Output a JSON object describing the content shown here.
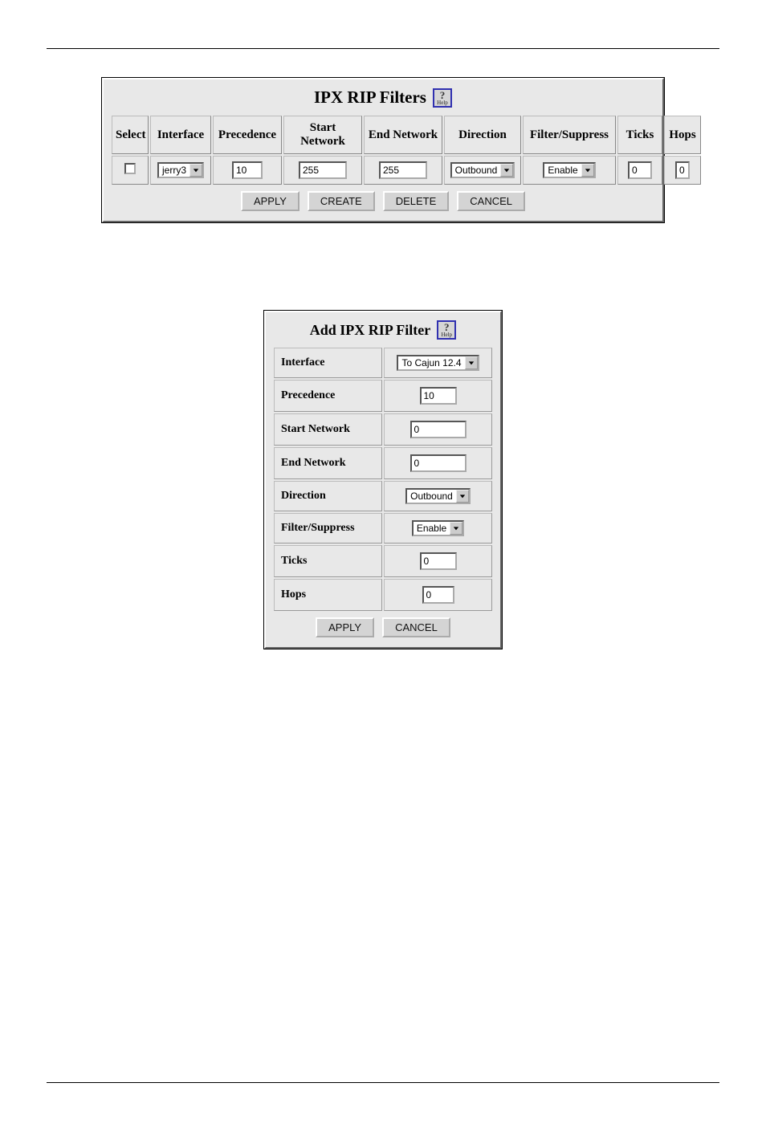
{
  "filters_panel": {
    "title": "IPX RIP Filters",
    "help_label": "Help",
    "columns": {
      "select": "Select",
      "interface": "Interface",
      "precedence": "Precedence",
      "start_network": "Start Network",
      "end_network": "End Network",
      "direction": "Direction",
      "filter_suppress": "Filter/Suppress",
      "ticks": "Ticks",
      "hops": "Hops"
    },
    "row": {
      "interface": "jerry3",
      "precedence": "10",
      "start_network": "255",
      "end_network": "255",
      "direction": "Outbound",
      "filter_suppress": "Enable",
      "ticks": "0",
      "hops": "0"
    },
    "buttons": {
      "apply": "APPLY",
      "create": "CREATE",
      "delete": "DELETE",
      "cancel": "CANCEL"
    }
  },
  "add_panel": {
    "title": "Add IPX RIP Filter",
    "help_label": "Help",
    "fields": {
      "interface_label": "Interface",
      "interface_value": "To Cajun 12.4",
      "precedence_label": "Precedence",
      "precedence_value": "10",
      "start_network_label": "Start Network",
      "start_network_value": "0",
      "end_network_label": "End Network",
      "end_network_value": "0",
      "direction_label": "Direction",
      "direction_value": "Outbound",
      "filter_suppress_label": "Filter/Suppress",
      "filter_suppress_value": "Enable",
      "ticks_label": "Ticks",
      "ticks_value": "0",
      "hops_label": "Hops",
      "hops_value": "0"
    },
    "buttons": {
      "apply": "APPLY",
      "cancel": "CANCEL"
    }
  }
}
